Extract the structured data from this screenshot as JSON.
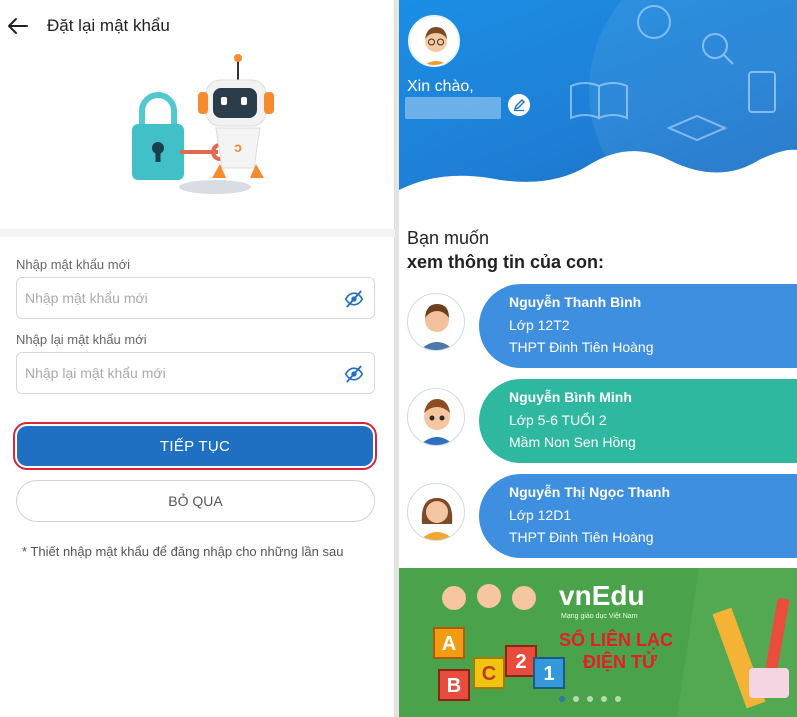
{
  "left": {
    "title": "Đặt lại mật khẩu",
    "new_password": {
      "label": "Nhập mật khẩu mới",
      "placeholder": "Nhập mật khẩu mới",
      "value": ""
    },
    "confirm_password": {
      "label": "Nhập lại mật khẩu mới",
      "placeholder": "Nhập lại mật khẩu mới",
      "value": ""
    },
    "continue_label": "TIẾP TỤC",
    "skip_label": "BỎ QUA",
    "note": "* Thiết nhập mật khẩu để đăng nhập cho những lần sau"
  },
  "right": {
    "greeting": "Xin chào,",
    "prompt_line1": "Bạn muốn",
    "prompt_line2": "xem thông tin của con:",
    "children": [
      {
        "name": "Nguyễn Thanh Bình",
        "class": "Lớp 12T2",
        "school": "THPT Đinh Tiên Hoàng",
        "color": "#3f8fe0"
      },
      {
        "name": "Nguyễn Bình Minh",
        "class": "Lớp 5-6 TUỔI 2",
        "school": "Mầm Non Sen Hồng",
        "color": "#2fb8a0"
      },
      {
        "name": "Nguyễn Thị Ngọc Thanh",
        "class": "Lớp 12D1",
        "school": "THPT Đinh Tiên Hoàng",
        "color": "#3f8fe0"
      }
    ],
    "banner": {
      "logo_vn": "vn",
      "logo_edu": "Edu",
      "tagline": "Mạng giáo dục Việt Nam",
      "slogan_line1": "SỔ LIÊN LẠC",
      "slogan_line2": "ĐIỆN TỬ",
      "blocks": [
        "A",
        "B",
        "C",
        "2",
        "1"
      ],
      "slide_count": 5,
      "active_slide": 1
    }
  },
  "colors": {
    "primary": "#1f6fc3",
    "highlight_border": "#d7263d",
    "hero": "#1a8ee3"
  },
  "icons": [
    "back-arrow-icon",
    "eye-off-icon",
    "edit-pencil-icon"
  ]
}
